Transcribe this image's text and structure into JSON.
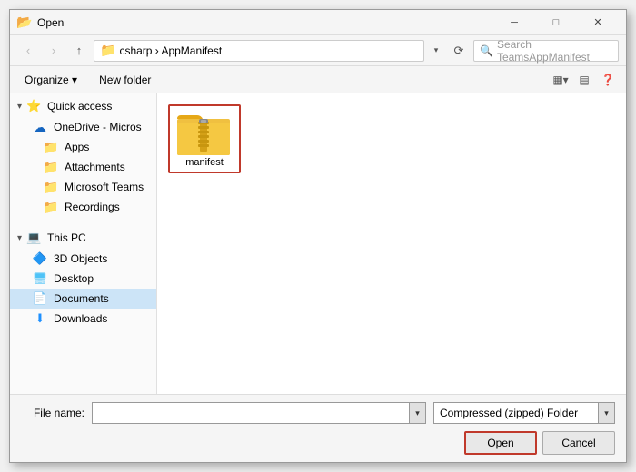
{
  "titleBar": {
    "icon": "📂",
    "title": "Open",
    "minBtn": "─",
    "maxBtn": "□",
    "closeBtn": "✕"
  },
  "toolbar": {
    "backDisabled": true,
    "forwardDisabled": true,
    "upBtn": "↑",
    "breadcrumb": "csharp  ›  AppManifest",
    "searchPlaceholder": "Search TeamsAppManifest",
    "refreshBtn": "⟳"
  },
  "subToolbar": {
    "organizeLabel": "Organize ▾",
    "newFolderLabel": "New folder",
    "viewOptions": [
      "▦",
      "▤",
      "❓"
    ]
  },
  "sidebar": {
    "quickAccess": {
      "label": "Quick access",
      "icon": "⭐"
    },
    "oneDrive": {
      "label": "OneDrive - Micros",
      "icon": "☁"
    },
    "items": [
      {
        "id": "apps",
        "label": "Apps",
        "icon": "📁",
        "color": "#e6a817"
      },
      {
        "id": "attachments",
        "label": "Attachments",
        "icon": "📁",
        "color": "#e6a817"
      },
      {
        "id": "microsoftTeams",
        "label": "Microsoft Teams",
        "icon": "📁",
        "color": "#e6a817"
      },
      {
        "id": "recordings",
        "label": "Recordings",
        "icon": "📁",
        "color": "#e6a817"
      }
    ],
    "thisPC": {
      "label": "This PC",
      "icon": "💻"
    },
    "pcItems": [
      {
        "id": "3dObjects",
        "label": "3D Objects",
        "icon": "🔷",
        "color": "#1e90ff"
      },
      {
        "id": "desktop",
        "label": "Desktop",
        "icon": "🖥",
        "color": "#4fc3f7"
      },
      {
        "id": "documents",
        "label": "Documents",
        "icon": "📄",
        "color": "#1e90ff",
        "selected": true
      },
      {
        "id": "downloads",
        "label": "Downloads",
        "icon": "⬇",
        "color": "#1e90ff"
      }
    ]
  },
  "content": {
    "files": [
      {
        "id": "manifest",
        "label": "manifest",
        "type": "zip"
      }
    ]
  },
  "bottomBar": {
    "fileNameLabel": "File name:",
    "fileNameValue": "",
    "fileTypeLabel": "Compressed (zipped) Folder",
    "openBtnLabel": "Open",
    "cancelBtnLabel": "Cancel"
  }
}
